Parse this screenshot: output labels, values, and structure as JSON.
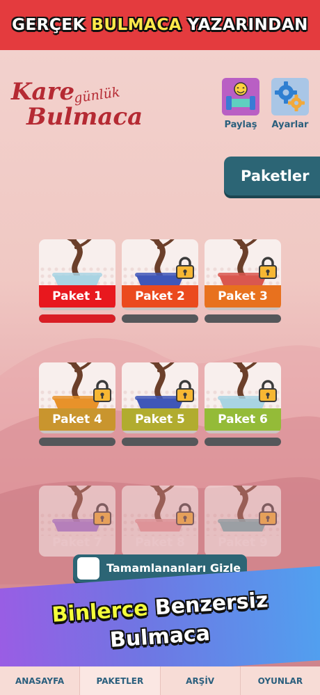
{
  "banner": {
    "part1": "GERÇEK ",
    "highlight": "BULMACA",
    "part2": " YAZARINDAN"
  },
  "logo": {
    "kare": "Kare",
    "gunluk": "günlük",
    "bulmaca": "Bulmaca"
  },
  "header_buttons": {
    "share_label": "Paylaş",
    "settings_label": "Ayarlar"
  },
  "packs_tab": {
    "label": "Paketler"
  },
  "packs": [
    {
      "label": "Paket 1",
      "color": "#e8181e",
      "locked": false,
      "progress": 1.0,
      "pot": "#a9d4e3",
      "leaves": "#7fb23a"
    },
    {
      "label": "Paket 2",
      "color": "#eb4a1e",
      "locked": true,
      "progress": 0.0,
      "pot": "#3f57b8",
      "leaves": "#7cd2c8"
    },
    {
      "label": "Paket 3",
      "color": "#e8711e",
      "locked": true,
      "progress": 0.0,
      "pot": "#d9574f",
      "leaves": "#6fbf7f"
    },
    {
      "label": "Paket 4",
      "color": "#c9952e",
      "locked": true,
      "progress": 0.0,
      "pot": "#e8922a",
      "leaves": "#ef7aa6"
    },
    {
      "label": "Paket 5",
      "color": "#b1ac2f",
      "locked": true,
      "progress": 0.0,
      "pot": "#3f57b8",
      "leaves": "#f26d7f"
    },
    {
      "label": "Paket 6",
      "color": "#94bb38",
      "locked": true,
      "progress": 0.0,
      "pot": "#a9d4e3",
      "leaves": "#49a889"
    },
    {
      "label": "Paket 7",
      "color": "#cf8a8f",
      "locked": true,
      "progress": 0.0,
      "pot": "#9e7be0",
      "leaves": "#e3455a"
    },
    {
      "label": "Paket 8",
      "color": "#cf8a8f",
      "locked": true,
      "progress": 0.0,
      "pot": "#e8a0a2",
      "leaves": "#5aa858"
    },
    {
      "label": "Paket 9",
      "color": "#cf8a8f",
      "locked": true,
      "progress": 0.0,
      "pot": "#6fb5b8",
      "leaves": "#8bc64a"
    }
  ],
  "hide_completed": {
    "label": "Tamamlananları Gizle",
    "checked": false
  },
  "promo": {
    "highlight": "Binlerce",
    "rest1": " Benzersiz",
    "line2": "Bulmaca"
  },
  "tabs": [
    {
      "label": "ANASAYFA",
      "active": false
    },
    {
      "label": "PAKETLER",
      "active": true
    },
    {
      "label": "ARŞİV",
      "active": false
    },
    {
      "label": "OYUNLAR",
      "active": false
    }
  ]
}
